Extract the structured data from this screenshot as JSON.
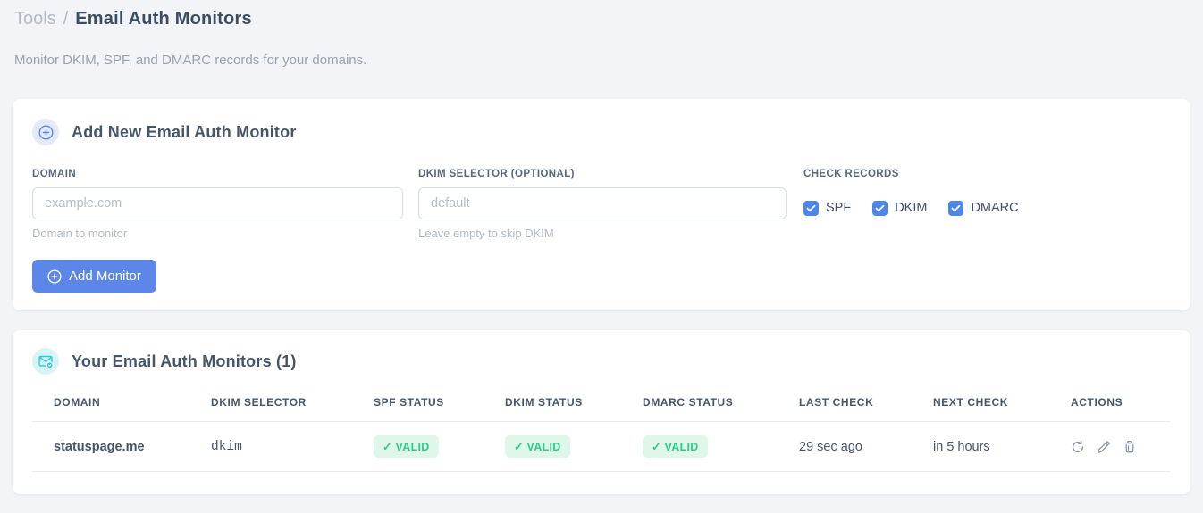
{
  "page": {
    "breadcrumb": {
      "parent": "Tools",
      "separator": "/",
      "current": "Email Auth Monitors"
    },
    "subtitle": "Monitor DKIM, SPF, and DMARC records for your domains."
  },
  "add_monitor_card": {
    "icon": "circle-plus-icon",
    "title": "Add New Email Auth Monitor",
    "fields": {
      "domain": {
        "label": "DOMAIN",
        "placeholder": "example.com",
        "value": "",
        "hint": "Domain to monitor"
      },
      "dkim_selector": {
        "label": "DKIM SELECTOR (OPTIONAL)",
        "placeholder": "default",
        "value": "",
        "hint": "Leave empty to skip DKIM"
      }
    },
    "check_records": {
      "label": "CHECK RECORDS",
      "options": [
        {
          "label": "SPF",
          "checked": true
        },
        {
          "label": "DKIM",
          "checked": true
        },
        {
          "label": "DMARC",
          "checked": true
        }
      ]
    },
    "submit": {
      "icon": "circle-plus-icon",
      "label": "Add Monitor"
    }
  },
  "monitors_card": {
    "icon": "envelope-check-icon",
    "title": "Your Email Auth Monitors (1)",
    "count": 1,
    "table": {
      "headers": [
        "DOMAIN",
        "DKIM SELECTOR",
        "SPF STATUS",
        "DKIM STATUS",
        "DMARC STATUS",
        "LAST CHECK",
        "NEXT CHECK",
        "ACTIONS"
      ],
      "rows": [
        {
          "domain": "statuspage.me",
          "dkim_selector": "dkim",
          "spf_status": "✓ VALID",
          "dkim_status": "✓ VALID",
          "dmarc_status": "✓ VALID",
          "last_check": "29 sec ago",
          "next_check": "in 5 hours",
          "actions": [
            "refresh-icon",
            "edit-icon",
            "delete-icon"
          ]
        }
      ]
    }
  },
  "colors": {
    "accent_blue": "#5c87e8",
    "checkbox_blue": "#4d86e8",
    "icon_teal": "#2bc9d9",
    "valid_text_green": "#2fcb8e",
    "valid_bg_green": "#def7e9",
    "selector_pink": "#ee4d7f",
    "page_bg": "#f2f4f7"
  }
}
